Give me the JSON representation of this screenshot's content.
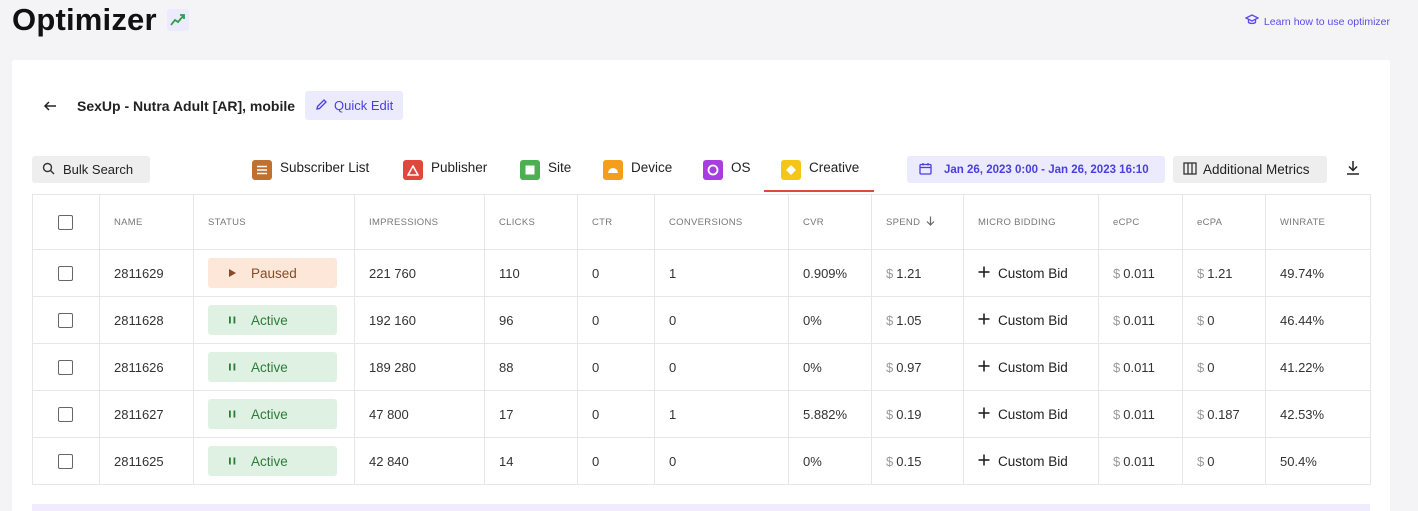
{
  "header": {
    "title": "Optimizer",
    "learn_link": "Learn how to use optimizer"
  },
  "campaign": {
    "name": "SexUp - Nutra Adult [AR], mobile",
    "quick_edit": "Quick Edit"
  },
  "toolbar": {
    "bulk_search": "Bulk Search",
    "tabs": [
      {
        "label": "Subscriber List",
        "color": "#c0712e"
      },
      {
        "label": "Publisher",
        "color": "#e0473d"
      },
      {
        "label": "Site",
        "color": "#4caf50"
      },
      {
        "label": "Device",
        "color": "#f59e1a"
      },
      {
        "label": "OS",
        "color": "#a83ee0"
      },
      {
        "label": "Creative",
        "color": "#f5c518"
      }
    ],
    "active_tab": "Creative",
    "date_range": "Jan 26, 2023 0:00 - Jan 26, 2023 16:10",
    "additional_metrics": "Additional Metrics"
  },
  "table": {
    "columns": [
      "NAME",
      "STATUS",
      "IMPRESSIONS",
      "CLICKS",
      "CTR",
      "CONVERSIONS",
      "CVR",
      "SPEND",
      "MICRO BIDDING",
      "eCPC",
      "eCPA",
      "WINRATE"
    ],
    "currency": "$",
    "rows": [
      {
        "name": "2811629",
        "status": "Paused",
        "impressions": "221 760",
        "clicks": "110",
        "ctr": "0",
        "conversions": "1",
        "cvr": "0.909%",
        "spend": "1.21",
        "micro_bidding": "Custom Bid",
        "ecpc": "0.011",
        "ecpa": "1.21",
        "winrate": "49.74%"
      },
      {
        "name": "2811628",
        "status": "Active",
        "impressions": "192 160",
        "clicks": "96",
        "ctr": "0",
        "conversions": "0",
        "cvr": "0%",
        "spend": "1.05",
        "micro_bidding": "Custom Bid",
        "ecpc": "0.011",
        "ecpa": "0",
        "winrate": "46.44%"
      },
      {
        "name": "2811626",
        "status": "Active",
        "impressions": "189 280",
        "clicks": "88",
        "ctr": "0",
        "conversions": "0",
        "cvr": "0%",
        "spend": "0.97",
        "micro_bidding": "Custom Bid",
        "ecpc": "0.011",
        "ecpa": "0",
        "winrate": "41.22%"
      },
      {
        "name": "2811627",
        "status": "Active",
        "impressions": "47 800",
        "clicks": "17",
        "ctr": "0",
        "conversions": "1",
        "cvr": "5.882%",
        "spend": "0.19",
        "micro_bidding": "Custom Bid",
        "ecpc": "0.011",
        "ecpa": "0.187",
        "winrate": "42.53%"
      },
      {
        "name": "2811625",
        "status": "Active",
        "impressions": "42 840",
        "clicks": "14",
        "ctr": "0",
        "conversions": "0",
        "cvr": "0%",
        "spend": "0.15",
        "micro_bidding": "Custom Bid",
        "ecpc": "0.011",
        "ecpa": "0",
        "winrate": "50.4%"
      }
    ]
  },
  "icons": {
    "trend": "trending-up-icon",
    "learn": "graduation-cap-icon",
    "back": "arrow-left-icon",
    "edit": "pencil-icon",
    "search": "search-icon",
    "calendar": "calendar-icon",
    "columns": "columns-icon",
    "download": "download-icon",
    "sort": "arrow-down-icon",
    "paused": "play-icon",
    "active": "pause-icon",
    "add": "plus-icon"
  }
}
